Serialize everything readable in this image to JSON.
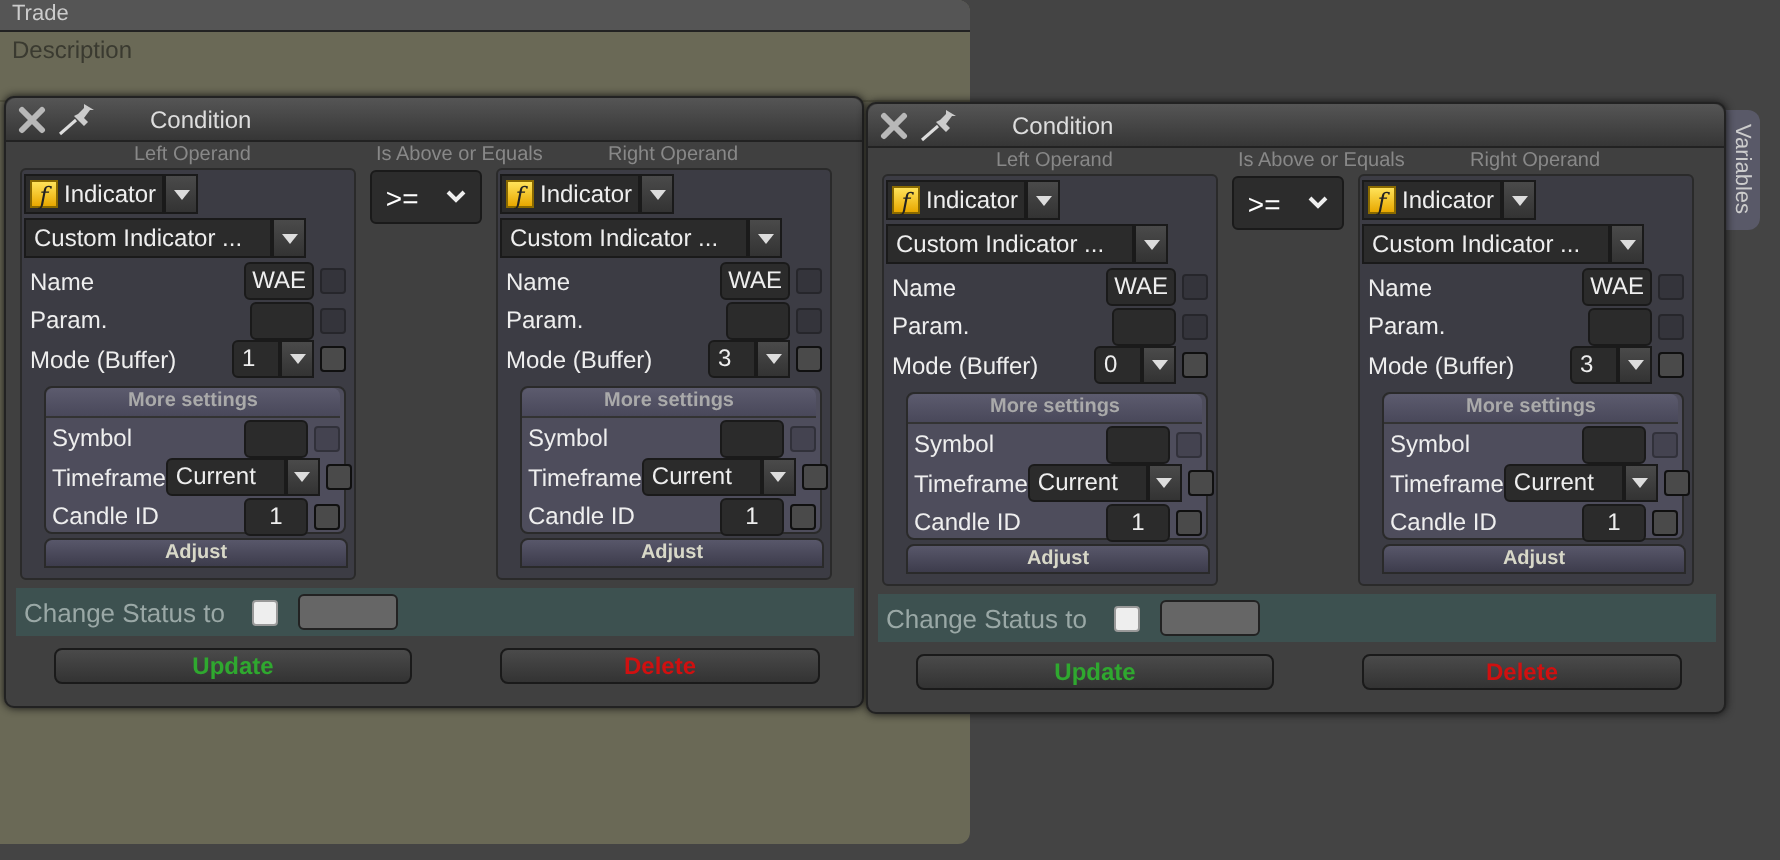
{
  "trade_window": {
    "title": "Trade",
    "description_placeholder": "Description"
  },
  "side_tab": {
    "label": "Variables"
  },
  "conditions": [
    {
      "title": "Condition",
      "left_label": "Left Operand",
      "operator_label": "Is Above or Equals",
      "right_label": "Right Operand",
      "operator": ">=",
      "operands": [
        {
          "icon": "f",
          "type": "Indicator",
          "indicator": "Custom Indicator ...",
          "fields": [
            {
              "kind": "text",
              "label": "Name",
              "value": "WAE",
              "check_disabled": true,
              "checked": false
            },
            {
              "kind": "text",
              "label": "Param.",
              "check_disabled": true,
              "checked": false
            },
            {
              "kind": "select",
              "label": "Mode (Buffer)",
              "value": "1",
              "check_disabled": false,
              "checked": false
            }
          ],
          "more_settings": "More settings",
          "settings": [
            {
              "kind": "text",
              "label": "Symbol",
              "check_disabled": true,
              "checked": false
            },
            {
              "kind": "wide",
              "label": "Timeframe",
              "value": "Current",
              "check_disabled": false,
              "checked": false
            },
            {
              "kind": "text",
              "label": "Candle ID",
              "value": "1",
              "check_disabled": false,
              "checked": false
            }
          ],
          "adjust": "Adjust"
        },
        {
          "icon": "f",
          "type": "Indicator",
          "indicator": "Custom Indicator ...",
          "fields": [
            {
              "kind": "text",
              "label": "Name",
              "value": "WAE",
              "check_disabled": true,
              "checked": false
            },
            {
              "kind": "text",
              "label": "Param.",
              "check_disabled": true,
              "checked": false
            },
            {
              "kind": "select",
              "label": "Mode (Buffer)",
              "value": "3",
              "check_disabled": false,
              "checked": false
            }
          ],
          "more_settings": "More settings",
          "settings": [
            {
              "kind": "text",
              "label": "Symbol",
              "check_disabled": true,
              "checked": false
            },
            {
              "kind": "wide",
              "label": "Timeframe",
              "value": "Current",
              "check_disabled": false,
              "checked": false
            },
            {
              "kind": "text",
              "label": "Candle ID",
              "value": "1",
              "check_disabled": false,
              "checked": false
            }
          ],
          "adjust": "Adjust"
        }
      ],
      "status_label": "Change Status to",
      "status_checked": false,
      "update": "Update",
      "delete": "Delete"
    },
    {
      "title": "Condition",
      "left_label": "Left Operand",
      "operator_label": "Is Above or Equals",
      "right_label": "Right Operand",
      "operator": ">=",
      "operands": [
        {
          "icon": "f",
          "type": "Indicator",
          "indicator": "Custom Indicator ...",
          "fields": [
            {
              "kind": "text",
              "label": "Name",
              "value": "WAE",
              "check_disabled": true,
              "checked": false
            },
            {
              "kind": "text",
              "label": "Param.",
              "check_disabled": true,
              "checked": false
            },
            {
              "kind": "select",
              "label": "Mode (Buffer)",
              "value": "0",
              "check_disabled": false,
              "checked": false
            }
          ],
          "more_settings": "More settings",
          "settings": [
            {
              "kind": "text",
              "label": "Symbol",
              "check_disabled": true,
              "checked": false
            },
            {
              "kind": "wide",
              "label": "Timeframe",
              "value": "Current",
              "check_disabled": false,
              "checked": false
            },
            {
              "kind": "text",
              "label": "Candle ID",
              "value": "1",
              "check_disabled": false,
              "checked": false
            }
          ],
          "adjust": "Adjust"
        },
        {
          "icon": "f",
          "type": "Indicator",
          "indicator": "Custom Indicator ...",
          "fields": [
            {
              "kind": "text",
              "label": "Name",
              "value": "WAE",
              "check_disabled": true,
              "checked": false
            },
            {
              "kind": "text",
              "label": "Param.",
              "check_disabled": true,
              "checked": false
            },
            {
              "kind": "select",
              "label": "Mode (Buffer)",
              "value": "3",
              "check_disabled": false,
              "checked": false
            }
          ],
          "more_settings": "More settings",
          "settings": [
            {
              "kind": "text",
              "label": "Symbol",
              "check_disabled": true,
              "checked": false
            },
            {
              "kind": "wide",
              "label": "Timeframe",
              "value": "Current",
              "check_disabled": false,
              "checked": false
            },
            {
              "kind": "text",
              "label": "Candle ID",
              "value": "1",
              "check_disabled": false,
              "checked": false
            }
          ],
          "adjust": "Adjust"
        }
      ],
      "status_label": "Change Status to",
      "status_checked": false,
      "update": "Update",
      "delete": "Delete"
    }
  ]
}
